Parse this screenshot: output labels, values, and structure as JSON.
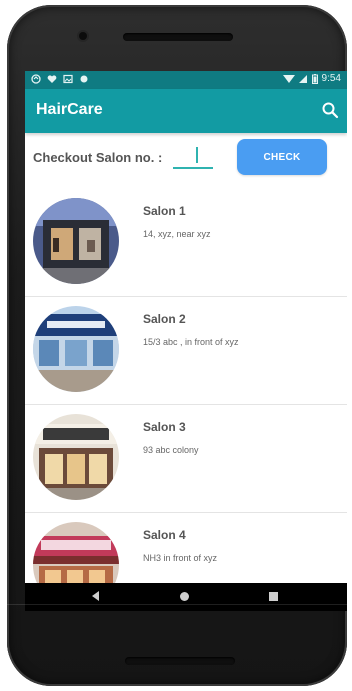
{
  "statusbar": {
    "time": "9:54",
    "left_icons": [
      "notification-icon",
      "heart-icon",
      "image-icon",
      "circle-icon"
    ],
    "right_icons": [
      "wifi-icon",
      "signal-icon",
      "battery-icon"
    ]
  },
  "appbar": {
    "title": "HairCare",
    "search_icon": "search-icon"
  },
  "checkout": {
    "label": "Checkout Salon no. :",
    "input_value": "",
    "button_label": "CHECK"
  },
  "salons": [
    {
      "name": "Salon 1",
      "address": "14, xyz, near xyz"
    },
    {
      "name": "Salon 2",
      "address": "15/3 abc , in front of xyz"
    },
    {
      "name": "Salon 3",
      "address": "93 abc colony"
    },
    {
      "name": "Salon 4",
      "address": "NH3 in front of xyz"
    }
  ],
  "colors": {
    "statusbar": "#0f7b82",
    "appbar": "#129ba3",
    "button": "#4a9df2",
    "input_underline": "#2fb3b0"
  },
  "navbar": {
    "icons": [
      "back-icon",
      "home-icon",
      "recents-icon"
    ]
  }
}
